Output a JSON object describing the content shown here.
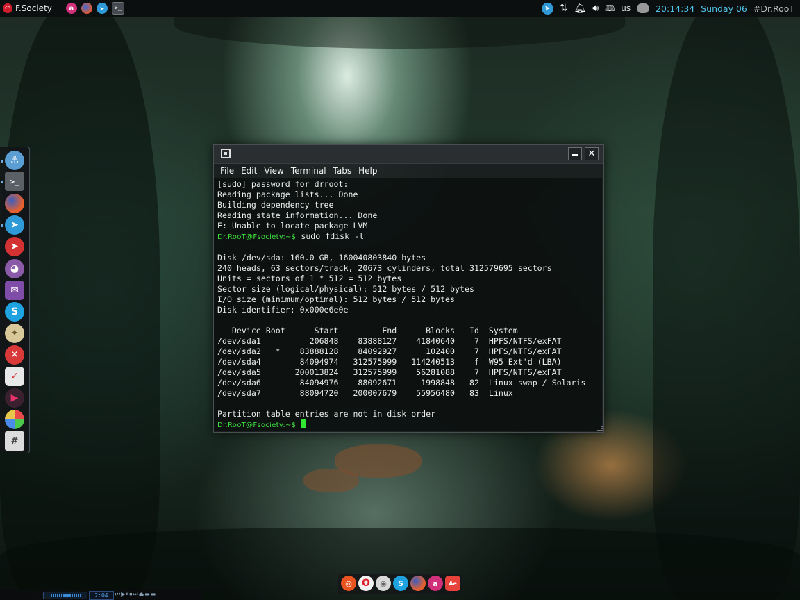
{
  "top_panel": {
    "app_name": "F.Society",
    "tray": {
      "keyboard_layout": "us"
    },
    "clock": {
      "time": "20:14:34",
      "day": "Sunday 06"
    },
    "hashtag": "#Dr.RooT"
  },
  "terminal": {
    "menu": [
      "File",
      "Edit",
      "View",
      "Terminal",
      "Tabs",
      "Help"
    ],
    "lines": {
      "l1": "[sudo] password for drroot:",
      "l2": "Reading package lists... Done",
      "l3": "Building dependency tree",
      "l4": "Reading state information... Done",
      "l5": "E: Unable to locate package LVM",
      "p1": "Dr.RooT@Fsociety:~$",
      "c1": " sudo fdisk -l",
      "d1": "Disk /dev/sda: 160.0 GB, 160040803840 bytes",
      "d2": "240 heads, 63 sectors/track, 20673 cylinders, total 312579695 sectors",
      "d3": "Units = sectors of 1 * 512 = 512 bytes",
      "d4": "Sector size (logical/physical): 512 bytes / 512 bytes",
      "d5": "I/O size (minimum/optimal): 512 bytes / 512 bytes",
      "d6": "Disk identifier: 0x000e6e0e",
      "h": "   Device Boot      Start         End      Blocks   Id  System",
      "r1": "/dev/sda1          206848    83888127    41840640    7  HPFS/NTFS/exFAT",
      "r2": "/dev/sda2   *    83888128    84092927      102400    7  HPFS/NTFS/exFAT",
      "r3": "/dev/sda4        84094974   312575999   114240513    f  W95 Ext'd (LBA)",
      "r4": "/dev/sda5       200013824   312575999    56281088    7  HPFS/NTFS/exFAT",
      "r5": "/dev/sda6        84094976    88092671     1998848   82  Linux swap / Solaris",
      "r6": "/dev/sda7        88094720   200007679    55956480   83  Linux",
      "n": "Partition table entries are not in disk order",
      "p2": "Dr.RooT@Fsociety:~$"
    }
  },
  "media_player": {
    "time": "2:04"
  },
  "colors": {
    "prompt": "#3fe03f",
    "clock": "#4fc3e8",
    "terminal_bg": "#0e1513"
  },
  "icons": {
    "left_dock": [
      "anchor-icon",
      "terminal-icon",
      "firefox-icon",
      "telegram-icon",
      "telegram-red-icon",
      "pidgin-icon",
      "mail-icon",
      "skype-icon",
      "globe-icon",
      "close-circle-icon",
      "task-icon",
      "video-player-icon",
      "color-icon",
      "text-editor-icon"
    ],
    "bottom_dock": [
      "ubuntu-icon",
      "opera-icon",
      "tv-icon",
      "skype-icon",
      "firefox-icon",
      "app-icon",
      "badge-icon"
    ]
  }
}
